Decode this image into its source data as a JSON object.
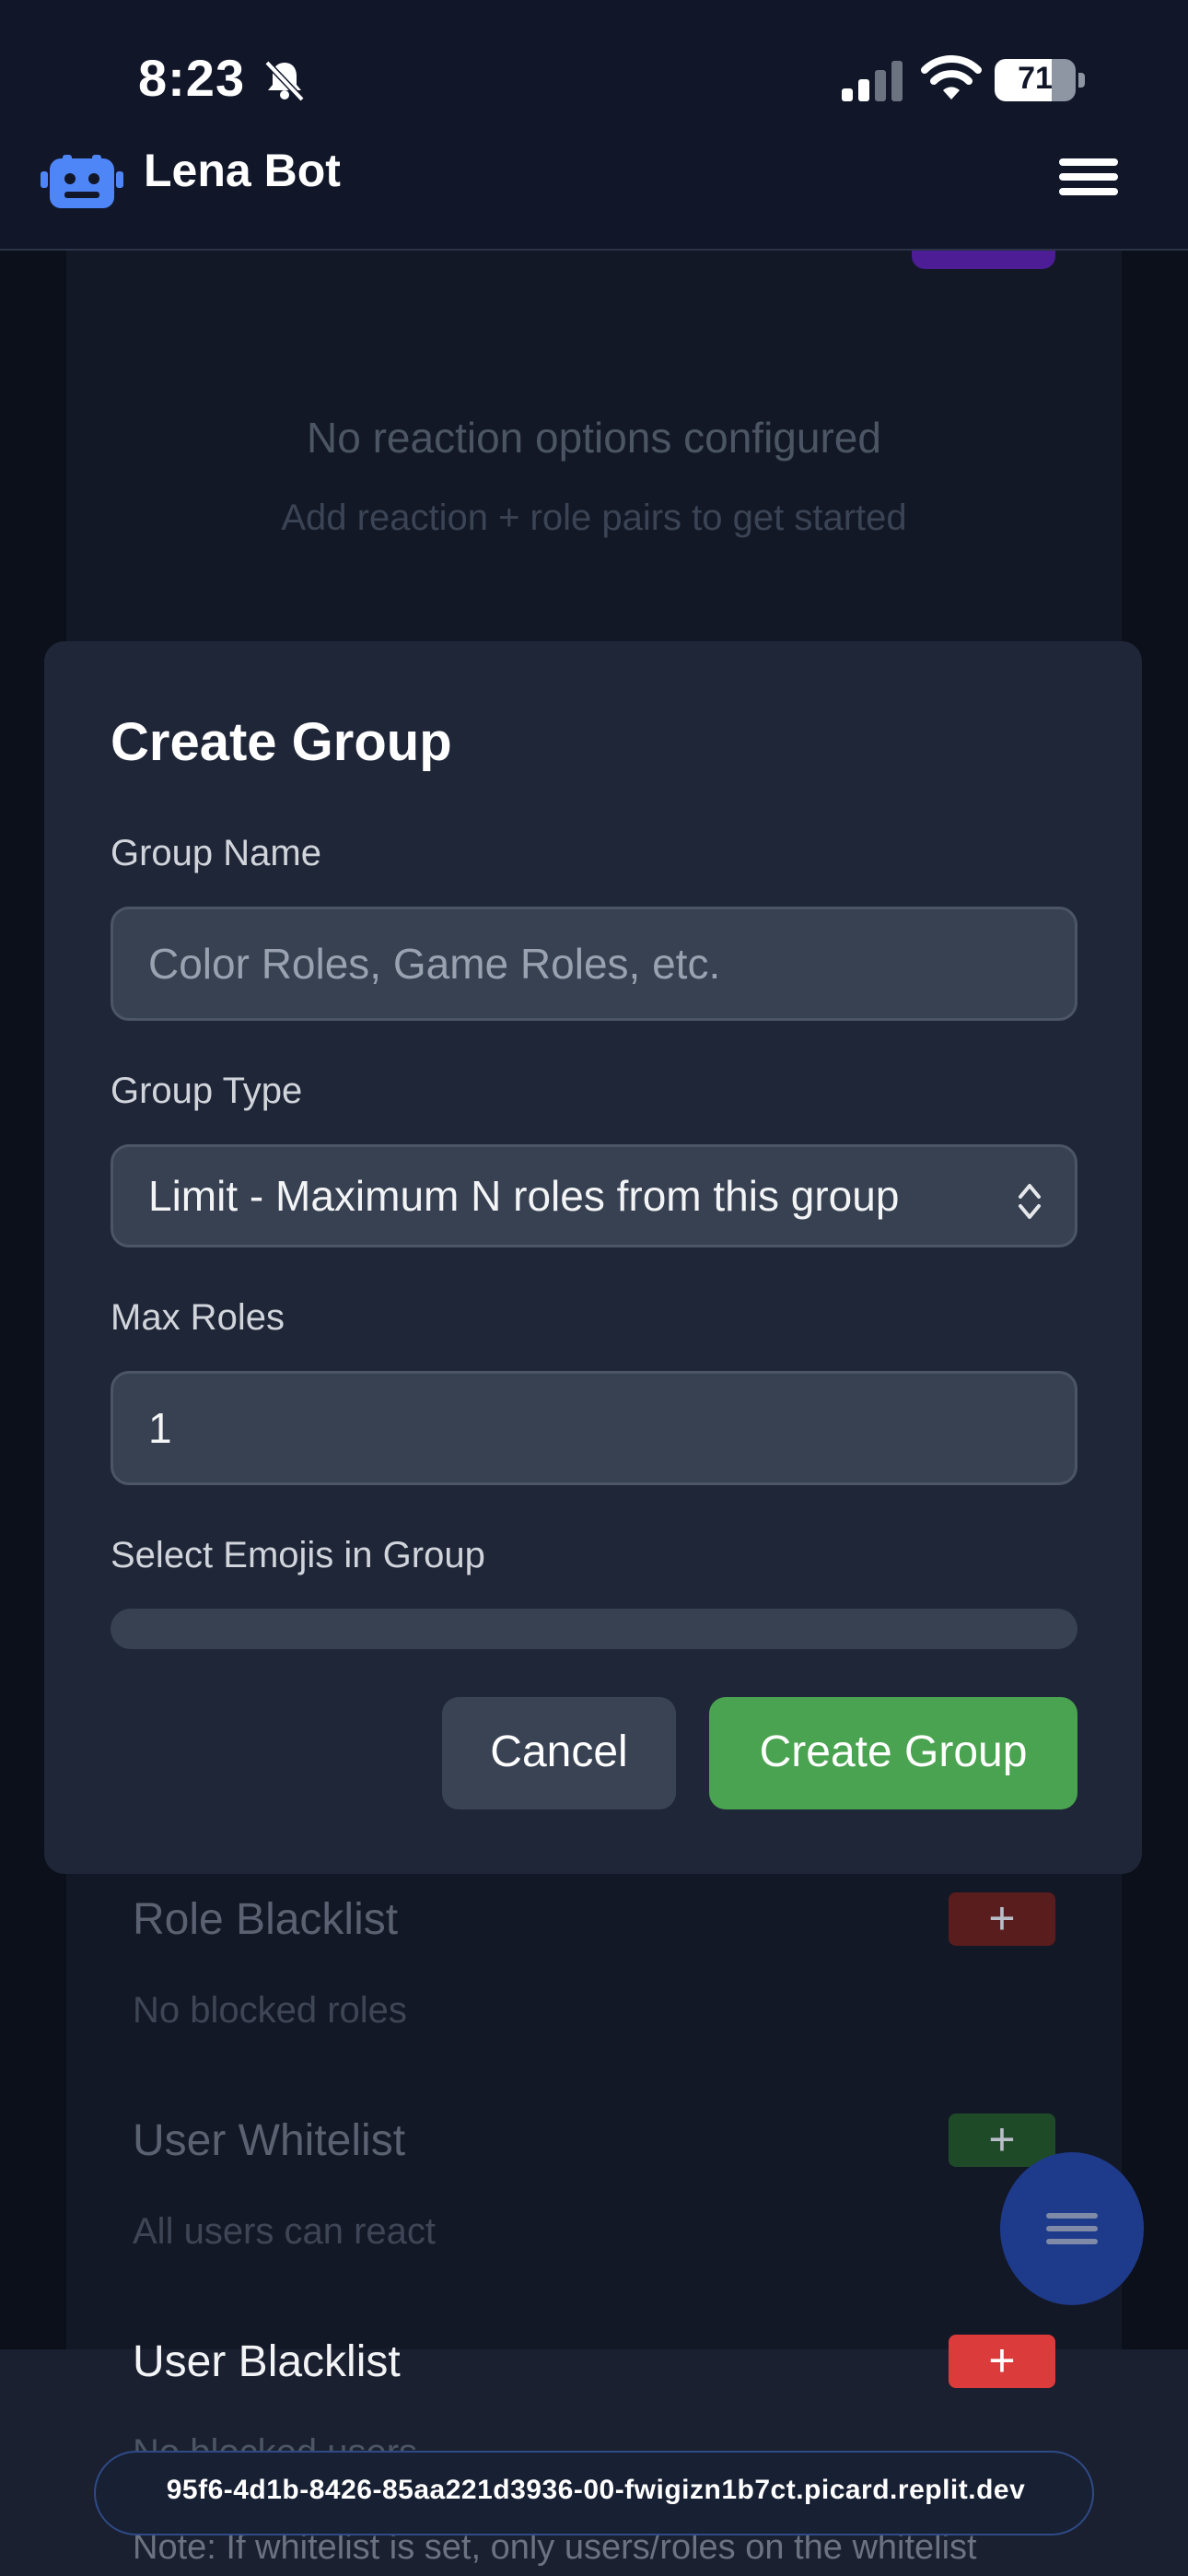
{
  "status_bar": {
    "time": "8:23",
    "battery": "71",
    "battery_fill": 0.71
  },
  "header": {
    "brand": "Lena Bot",
    "menu_icon": "hamburger-icon",
    "logo_icon": "robot-icon"
  },
  "background": {
    "empty_title": "No reaction options configured",
    "empty_subtitle": "Add reaction + role pairs to get started",
    "role_blacklist": {
      "title": "Role Blacklist",
      "subtitle": "No blocked roles",
      "add": "+",
      "color": "#5a1d1d"
    },
    "user_whitelist": {
      "title": "User Whitelist",
      "subtitle": "All users can react",
      "add": "+",
      "color": "#1f4a28"
    },
    "user_blacklist": {
      "title": "User Blacklist",
      "subtitle": "No blocked users",
      "add": "+",
      "color": "#dc3b3b"
    },
    "note": "Note: If whitelist is set, only users/roles on the whitelist"
  },
  "modal": {
    "title": "Create Group",
    "group_name_label": "Group Name",
    "group_name_placeholder": "Color Roles, Game Roles, etc.",
    "group_name_value": "",
    "group_type_label": "Group Type",
    "group_type_value": "Limit - Maximum N roles from this group",
    "max_roles_label": "Max Roles",
    "max_roles_value": "1",
    "emoji_label": "Select Emojis in Group",
    "cancel_label": "Cancel",
    "create_label": "Create Group",
    "accent": "#4aa350"
  },
  "url_bar": {
    "text": "95f6-4d1b-8426-85aa221d3936-00-fwigizn1b7ct.picard.replit.dev"
  }
}
